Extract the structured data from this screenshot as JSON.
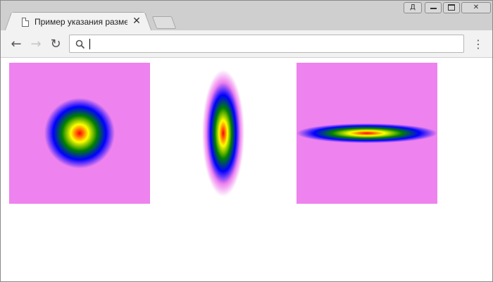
{
  "tab": {
    "title": "Пример указания размера",
    "close_glyph": "✕",
    "icon": "page-icon"
  },
  "window_controls": {
    "user_label": "Д",
    "minimize_glyph": "▁",
    "maximize_glyph": "□",
    "close_glyph": "✕"
  },
  "toolbar": {
    "back_glyph": "←",
    "forward_glyph": "→",
    "reload_glyph": "↻",
    "menu_glyph": "⋮",
    "address_value": "",
    "address_placeholder": ""
  },
  "content": {
    "gradients": [
      {
        "name": "circle",
        "colors": [
          "#ff0000",
          "#ffff00",
          "#008000",
          "#0000ff",
          "#ee82ee"
        ],
        "background": "#ee82ee"
      },
      {
        "name": "vertical-ellipse",
        "colors": [
          "#ff0000",
          "#ffff00",
          "#008000",
          "#0000ff",
          "#ee82ee"
        ],
        "background": "#ffffff"
      },
      {
        "name": "horizontal-ellipse",
        "colors": [
          "#ff0000",
          "#ffff00",
          "#008000",
          "#0000ff",
          "#ee82ee"
        ],
        "background": "#ee82ee"
      }
    ]
  }
}
